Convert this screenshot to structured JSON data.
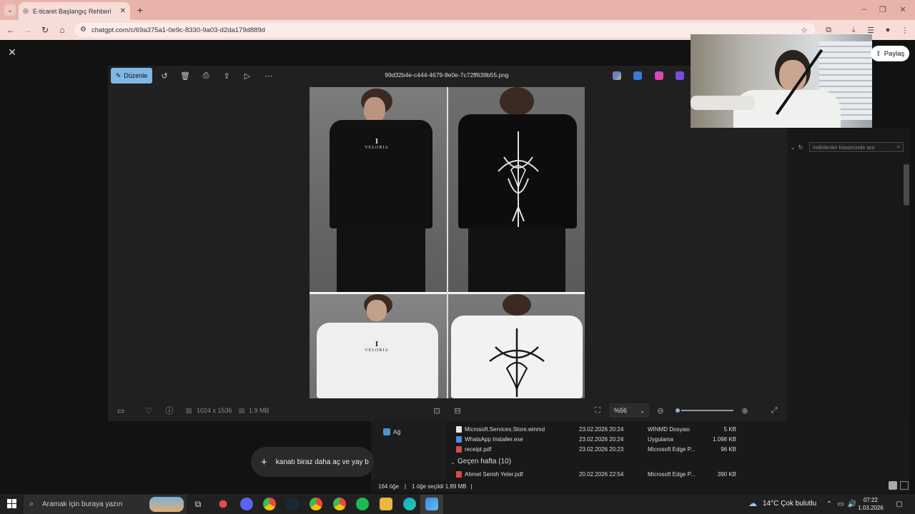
{
  "browser": {
    "tab_title": "E-ticaret Başlangıç Rehberi",
    "url": "chatgpt.com/c/69a375a1-0e9c-8330-9a03-d2da179d889d"
  },
  "viewer": {
    "edit_label": "Düzenle",
    "filename": "99d32b4e-c444-4679-8e0e-7c72ff639b55.png",
    "dimensions": "1024 x 1536",
    "filesize": "1.9 MB",
    "zoom": "%56",
    "zoom_level": 0.05,
    "brand_letter": "I",
    "brand_name": "VELORIA"
  },
  "share": {
    "label": "Paylaş"
  },
  "explorer": {
    "search_placeholder": "İndirilenler klasöründe ara",
    "nav_item": "Ağ",
    "files": [
      {
        "name": "Microsoft.Services.Store.winmd",
        "date": "23.02.2026 20:24",
        "type": "WINMD Dosyası",
        "size": "5 KB",
        "icon_color": "#e8e8e8"
      },
      {
        "name": "WhatsApp Installer.exe",
        "date": "23.02.2026 20:24",
        "type": "Uygulama",
        "size": "1.098 KB",
        "icon_color": "#4d8fd6"
      },
      {
        "name": "receipt.pdf",
        "date": "23.02.2026 20:23",
        "type": "Microsoft Edge P...",
        "size": "96 KB",
        "icon_color": "#d84a4a"
      }
    ],
    "group_header": "Geçen hafta (10)",
    "files_group2": [
      {
        "name": "Ahmet Semih Yeter.pdf",
        "date": "20.02.2026 22:54",
        "type": "Microsoft Edge P...",
        "size": "390 KB",
        "icon_color": "#d84a4a"
      }
    ],
    "status_count": "164 öğe",
    "status_selection": "1 öğe seçildi  1,89 MB"
  },
  "composer": {
    "text": "kanatı biraz daha aç ve yay b"
  },
  "taskbar": {
    "search_placeholder": "Aramak için buraya yazın",
    "weather": "14°C  Çok bulutlu",
    "time": "07:22",
    "date": "1.03.2026"
  },
  "colors": {
    "accent": "#7fb7e6",
    "tab_bar": "#e8b3aa",
    "viewer_bg": "#202020"
  }
}
